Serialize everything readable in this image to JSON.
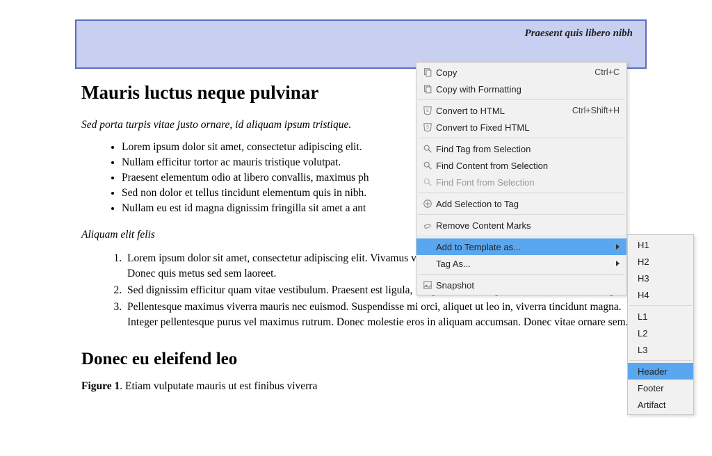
{
  "header": {
    "text": "Praesent quis libero nibh"
  },
  "doc": {
    "h1": "Mauris luctus neque pulvinar",
    "subtitle": "Sed porta turpis vitae justo ornare, id aliquam ipsum tristique.",
    "bullets": [
      "Lorem ipsum dolor sit amet, consectetur adipiscing elit.",
      "Nullam efficitur tortor ac mauris tristique volutpat.",
      "Praesent elementum odio at libero convallis, maximus ph",
      "Sed non dolor et tellus tincidunt elementum quis in nibh.",
      "Nullam eu est id magna dignissim fringilla sit amet a ant"
    ],
    "section_label": "Aliquam elit felis",
    "numbered": [
      "Lorem ipsum dolor sit amet, consectetur adipiscing elit. Vivamus varius nunc ante, tempus rhoncus non a enim. Donec quis metus sed sem laoreet.",
      "Sed dignissim efficitur quam vitae vestibulum. Praesent est ligula, fringilla sit amet egestas at convallis vitae augue.",
      "Pellentesque maximus viverra mauris nec euismod. Suspendisse mi orci, aliquet ut leo in, viverra tincidunt magna. Integer pellentesque purus vel maximus rutrum. Donec molestie eros in aliquam accumsan. Donec vitae ornare sem."
    ],
    "h2": "Donec eu eleifend leo",
    "figure_label": "Figure 1",
    "figure_caption": ". Etiam vulputate mauris ut est finibus viverra"
  },
  "menu": {
    "copy": "Copy",
    "copy_shortcut": "Ctrl+C",
    "copy_fmt": "Copy with Formatting",
    "conv_html": "Convert to HTML",
    "conv_html_shortcut": "Ctrl+Shift+H",
    "conv_fixed": "Convert to Fixed HTML",
    "find_tag": "Find Tag from Selection",
    "find_content": "Find Content from Selection",
    "find_font": "Find Font from Selection",
    "add_sel": "Add Selection to Tag",
    "remove_marks": "Remove Content Marks",
    "add_template": "Add to Template as...",
    "tag_as": "Tag As...",
    "snapshot": "Snapshot"
  },
  "submenu": {
    "h1": "H1",
    "h2": "H2",
    "h3": "H3",
    "h4": "H4",
    "l1": "L1",
    "l2": "L2",
    "l3": "L3",
    "header": "Header",
    "footer": "Footer",
    "artifact": "Artifact"
  }
}
